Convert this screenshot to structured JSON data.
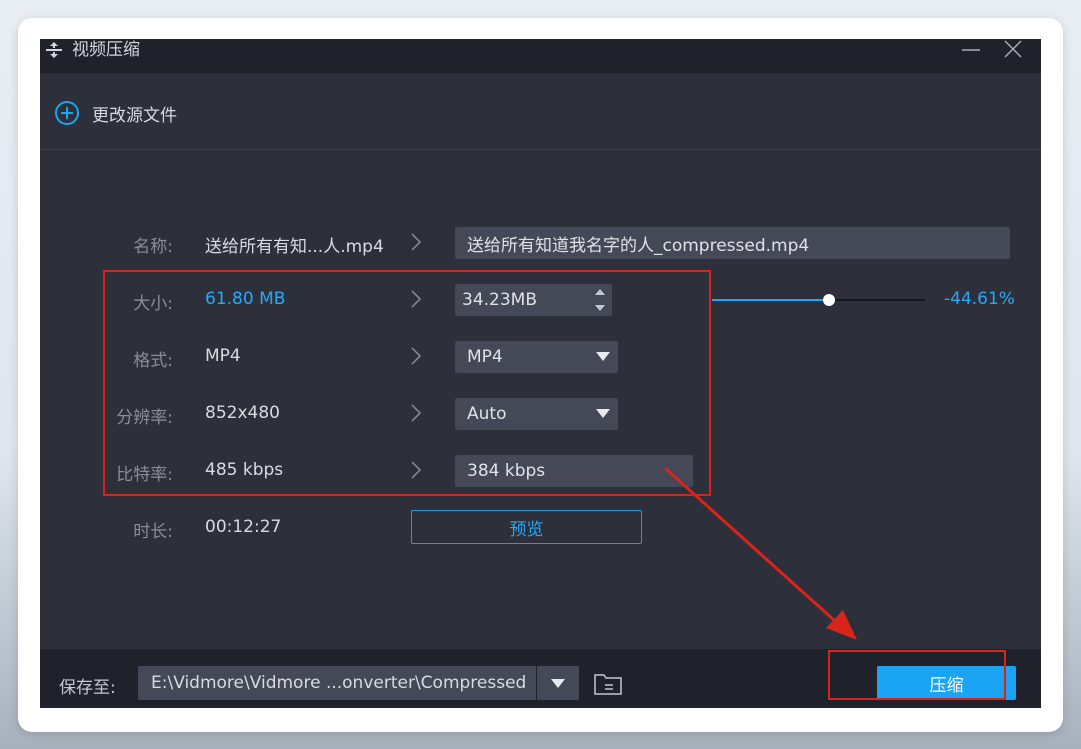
{
  "window": {
    "title": "视频压缩",
    "change_source": "更改源文件"
  },
  "rows": {
    "name": {
      "label": "名称:",
      "source": "送给所有有知...人.mp4",
      "target": "送给所有知道我名字的人_compressed.mp4"
    },
    "size": {
      "label": "大小:",
      "source": "61.80 MB",
      "target": "34.23MB",
      "reduction": "-44.61%",
      "slider_fraction": 0.55
    },
    "format": {
      "label": "格式:",
      "source": "MP4",
      "target": "MP4"
    },
    "resolution": {
      "label": "分辨率:",
      "source": "852x480",
      "target": "Auto"
    },
    "bitrate": {
      "label": "比特率:",
      "source": "485 kbps",
      "target": "384 kbps"
    },
    "duration": {
      "label": "时长:",
      "source": "00:12:27"
    }
  },
  "preview_label": "预览",
  "footer": {
    "save_label": "保存至:",
    "path": "E:\\Vidmore\\Vidmore ...onverter\\Compressed",
    "compress_label": "压缩"
  },
  "colors": {
    "accent": "#1ba4f3",
    "window_bg": "#2d2f3b",
    "titlebar_bg": "#20222b",
    "annotation_red": "#d9231b"
  }
}
